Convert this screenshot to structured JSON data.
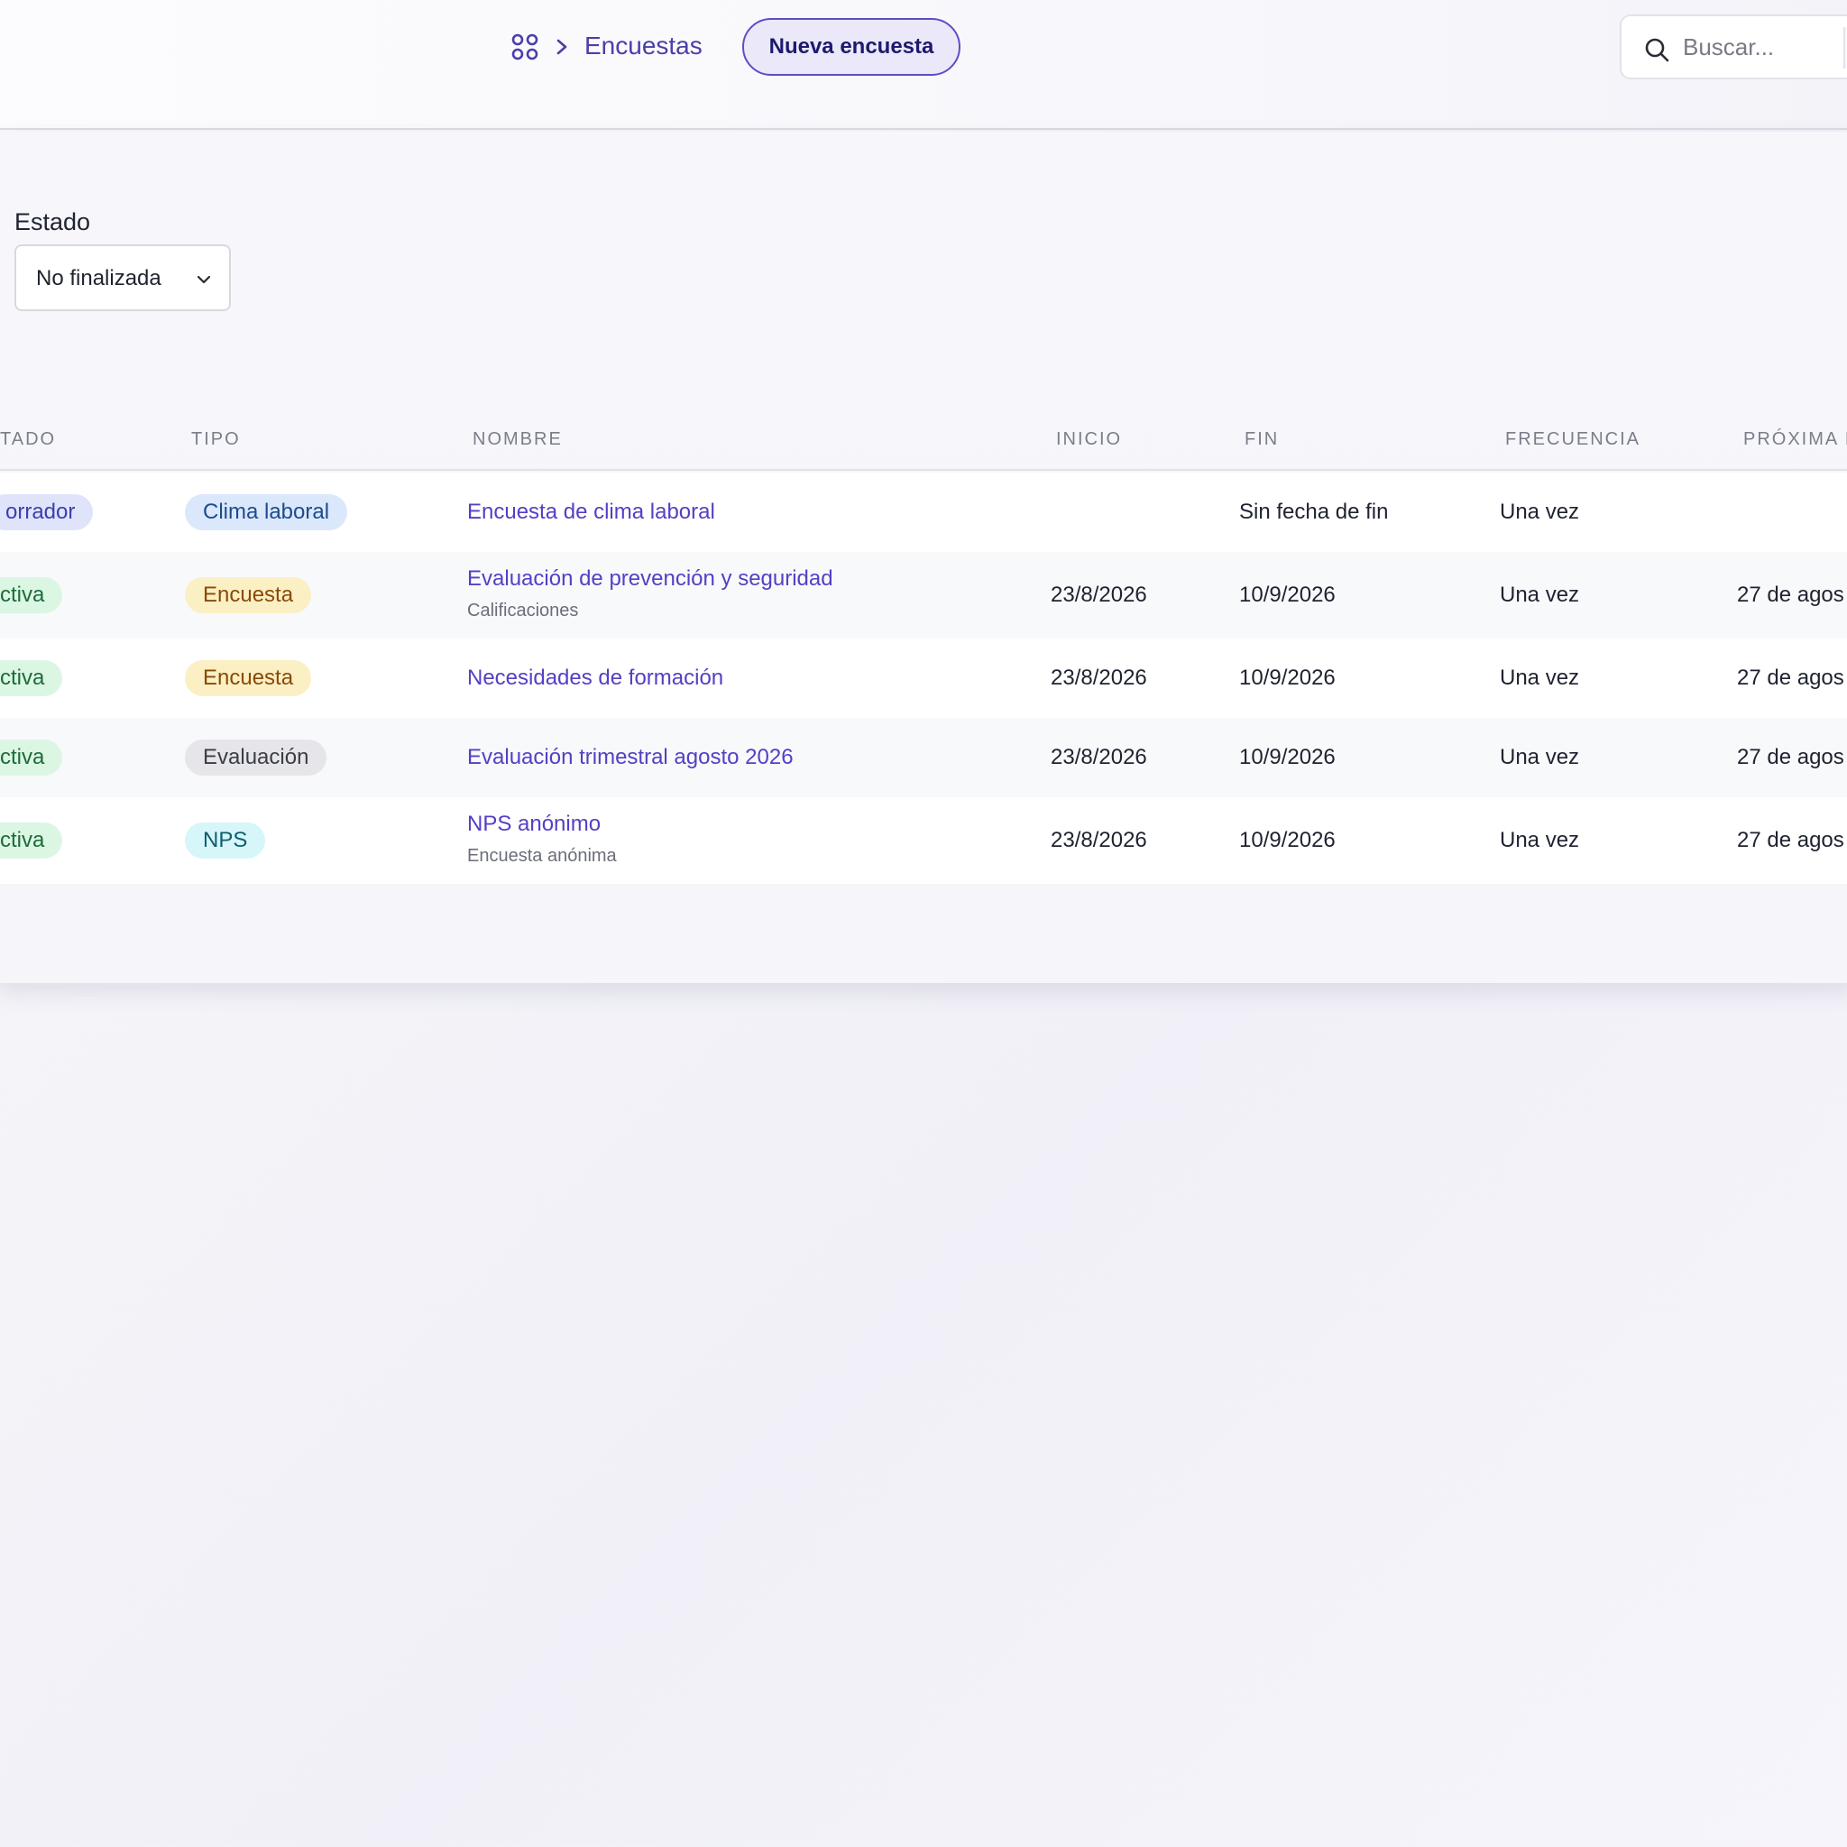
{
  "header": {
    "breadcrumb_label": "Encuestas",
    "new_button_label": "Nueva encuesta",
    "search_placeholder": "Buscar..."
  },
  "filters": {
    "estado_label": "Estado",
    "estado_value": "No finalizada"
  },
  "table": {
    "columns": [
      "TADO",
      "TIPO",
      "NOMBRE",
      "INICIO",
      "FIN",
      "FRECUENCIA",
      "PRÓXIMA I"
    ],
    "rows": [
      {
        "estado": "orrador",
        "tipo": "Clima laboral",
        "nombre": "Encuesta de clima laboral",
        "subtitulo": "",
        "inicio": "",
        "fin": "Sin fecha de fin",
        "frecuencia": "Una vez",
        "proxima": ""
      },
      {
        "estado": "ctiva",
        "tipo": "Encuesta",
        "nombre": "Evaluación de prevención y seguridad",
        "subtitulo": "Calificaciones",
        "inicio": "23/8/2026",
        "fin": "10/9/2026",
        "frecuencia": "Una vez",
        "proxima": "27 de agos"
      },
      {
        "estado": "ctiva",
        "tipo": "Encuesta",
        "nombre": "Necesidades de formación",
        "subtitulo": "",
        "inicio": "23/8/2026",
        "fin": "10/9/2026",
        "frecuencia": "Una vez",
        "proxima": "27 de agos"
      },
      {
        "estado": "ctiva",
        "tipo": "Evaluación",
        "nombre": "Evaluación trimestral agosto 2026",
        "subtitulo": "",
        "inicio": "23/8/2026",
        "fin": "10/9/2026",
        "frecuencia": "Una vez",
        "proxima": "27 de agos"
      },
      {
        "estado": "ctiva",
        "tipo": "NPS",
        "nombre": "NPS anónimo",
        "subtitulo": "Encuesta anónima",
        "inicio": "23/8/2026",
        "fin": "10/9/2026",
        "frecuencia": "Una vez",
        "proxima": "27 de agos"
      }
    ]
  },
  "colors": {
    "accent": "#5340c4",
    "button_border": "#5b4fc4",
    "badge_activa": "#dcf6e4",
    "badge_borrador": "#dfe4fb",
    "badge_clima": "#dbe7fb",
    "badge_encuesta": "#fbefc4",
    "badge_evaluacion": "#e6e6ea",
    "badge_nps": "#d6f6fa"
  },
  "icons": {
    "breadcrumb_home": "apps-grid-icon",
    "breadcrumb_separator": "chevron-right-icon",
    "search": "search-icon",
    "select": "chevron-down-icon"
  }
}
